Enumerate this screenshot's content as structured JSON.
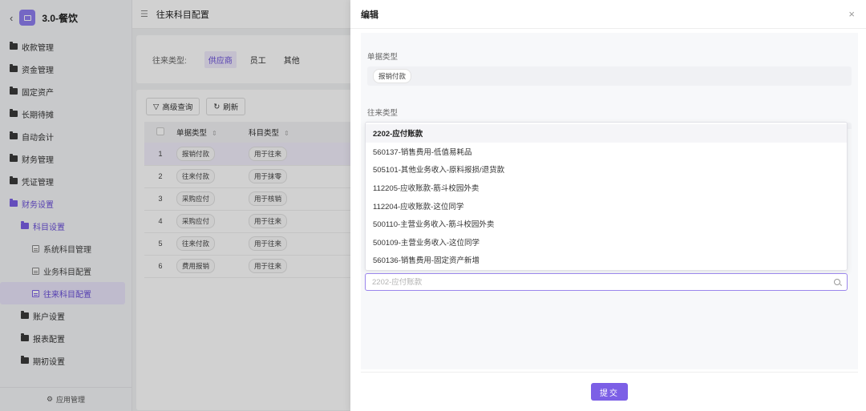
{
  "app": {
    "back": "‹",
    "name": "3.0-餐饮",
    "brand_color": "#8e7ef0"
  },
  "sidebar": {
    "items": [
      {
        "label": "收款管理"
      },
      {
        "label": "资金管理"
      },
      {
        "label": "固定资产"
      },
      {
        "label": "长期待摊"
      },
      {
        "label": "自动会计"
      },
      {
        "label": "财务管理"
      },
      {
        "label": "凭证管理"
      },
      {
        "label": "财务设置"
      },
      {
        "label": "科目设置"
      },
      {
        "label": "系统科目管理"
      },
      {
        "label": "业务科目配置"
      },
      {
        "label": "往来科目配置"
      },
      {
        "label": "账户设置"
      },
      {
        "label": "报表配置"
      },
      {
        "label": "期初设置"
      }
    ],
    "footer": "应用管理"
  },
  "topbar": {
    "title": "往来科目配置"
  },
  "filter": {
    "label": "往来类型:",
    "options": [
      "供应商",
      "员工",
      "其他"
    ],
    "selected": "供应商"
  },
  "toolbar": {
    "advanced_search": "高级查询",
    "refresh": "刷新"
  },
  "table": {
    "headers": [
      "单据类型",
      "科目类型"
    ],
    "rows": [
      {
        "no": "1",
        "doc_type": "报销付款",
        "subject_type": "用于往来"
      },
      {
        "no": "2",
        "doc_type": "往来付款",
        "subject_type": "用于抹零"
      },
      {
        "no": "3",
        "doc_type": "采购应付",
        "subject_type": "用于核销"
      },
      {
        "no": "4",
        "doc_type": "采购应付",
        "subject_type": "用于往来"
      },
      {
        "no": "5",
        "doc_type": "往来付款",
        "subject_type": "用于往来"
      },
      {
        "no": "6",
        "doc_type": "费用报销",
        "subject_type": "用于往来"
      }
    ]
  },
  "drawer": {
    "title": "编辑",
    "close": "×",
    "field1_label": "单据类型",
    "field1_value": "报销付款",
    "field2_label": "往来类型",
    "dropdown": [
      "2202-应付账款",
      "560137-销售费用-低值易耗品",
      "505101-其他业务收入-原料报损/退货款",
      "112205-应收账款-筋斗校园外卖",
      "112204-应收账款-这位同学",
      "500110-主营业务收入-筋斗校园外卖",
      "500109-主营业务收入-这位同学",
      "560136-销售费用-固定资产新增"
    ],
    "search_placeholder": "2202-应付账款",
    "submit": "提交"
  },
  "colors": {
    "accent": "#7c5fe6",
    "selected_bg": "#efebfc"
  }
}
